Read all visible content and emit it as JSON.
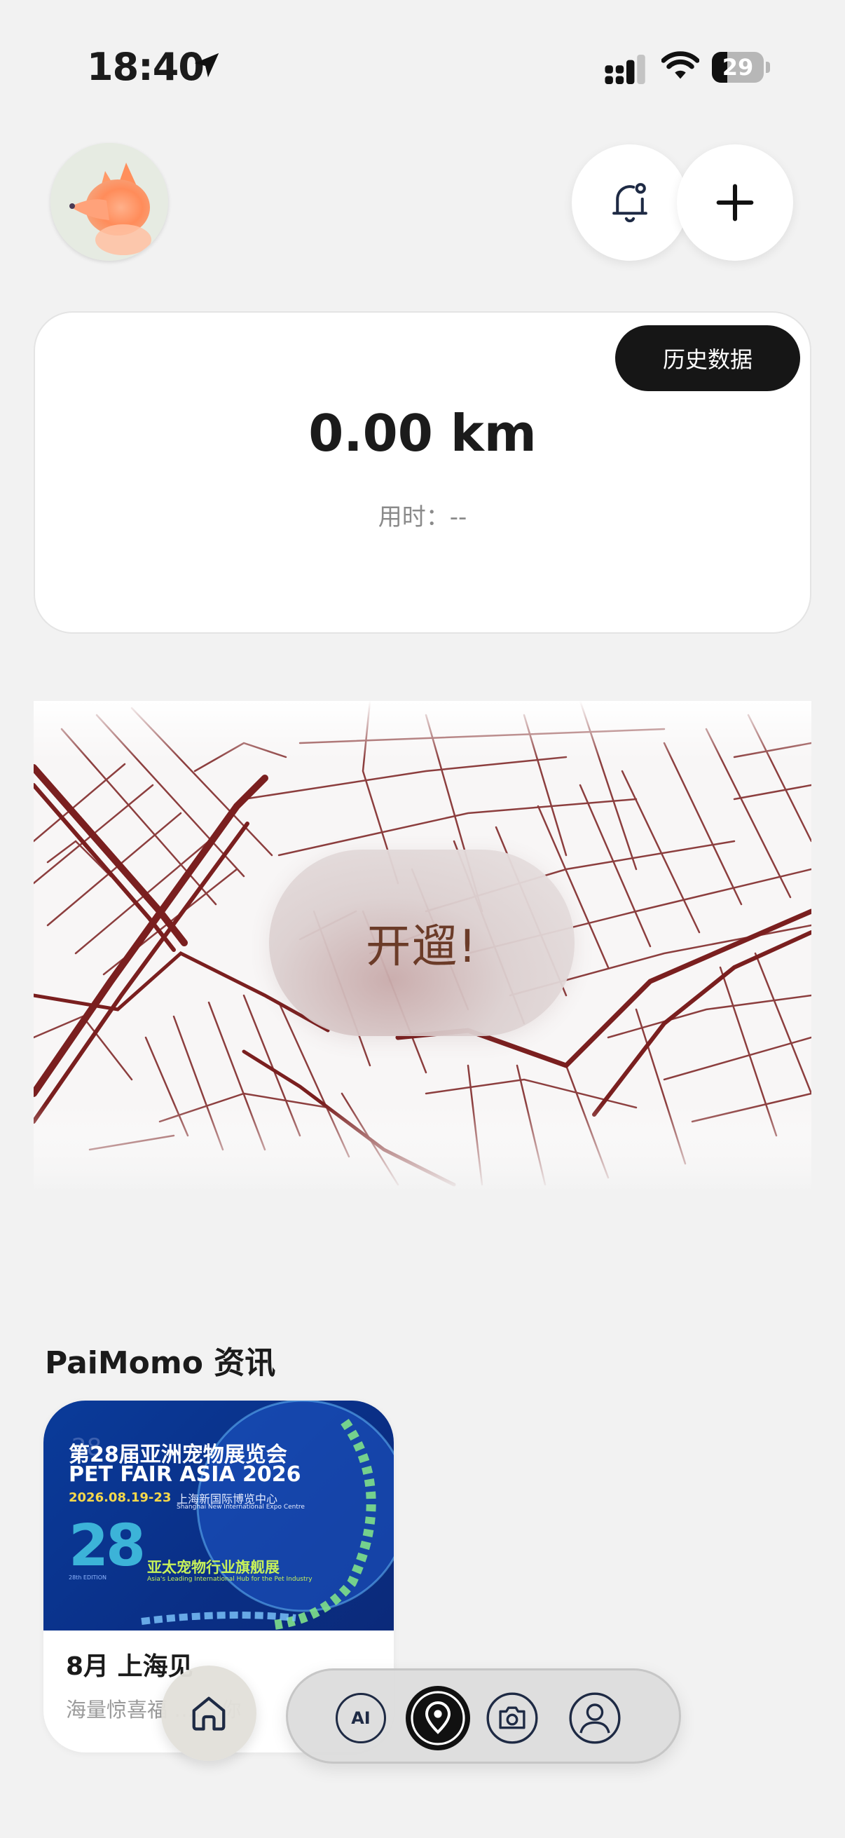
{
  "status_bar": {
    "time": "18:40",
    "battery": "29",
    "icons": [
      "location-arrow-icon",
      "cellular-signal-icon",
      "wifi-icon",
      "battery-icon"
    ]
  },
  "header": {
    "avatar": "fox-avatar",
    "icons": [
      "bell-icon",
      "plus-icon"
    ]
  },
  "distance_card": {
    "history_label": "历史数据",
    "distance": "0.00 km",
    "duration": "用时：--"
  },
  "map": {
    "start_label": "开遛!",
    "road_color": "#7a1f1f"
  },
  "news": {
    "section_title": "PaiMomo 资讯",
    "cards": [
      {
        "image_line1": "第28届亚洲宠物展览会",
        "image_line2": "PET FAIR ASIA 2026",
        "image_date": "2026.08.19-23",
        "image_venue": "上海新国际博览中心",
        "image_venue_en": "Shanghai New International Expo Centre",
        "image_number": "28",
        "image_edition": "28th EDITION",
        "image_tagline": "亚太宠物行业旗舰展",
        "image_tagline_en": "Asia's Leading International Hub for the Pet Industry",
        "headline": "8月 上海见",
        "subtitle": "海量惊喜福 …… 你"
      }
    ]
  },
  "bottom_nav": {
    "ai_label": "AI",
    "items": [
      "home-icon",
      "ai-icon",
      "location-pin-icon",
      "camera-icon",
      "profile-icon"
    ],
    "active": "location-pin-icon"
  },
  "colors": {
    "background": "#f2f2f2",
    "accent_dark": "#161616",
    "start_text": "#6b3b28",
    "news_blue": "#0a3b9a"
  }
}
